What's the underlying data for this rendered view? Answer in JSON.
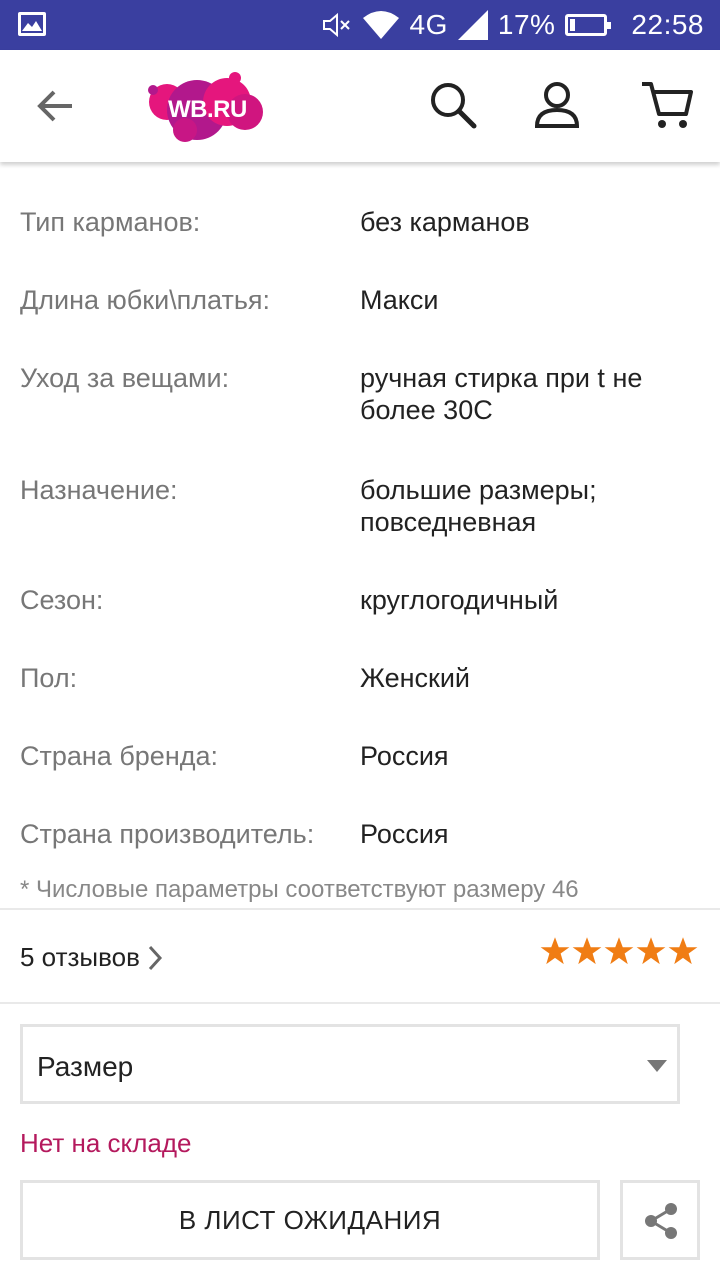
{
  "status_bar": {
    "network": "4G",
    "battery_percent": "17%",
    "battery_level": 0.17,
    "time": "22:58",
    "icons": [
      "gallery-icon",
      "mute-icon",
      "wifi-icon",
      "signal-icon",
      "battery-icon"
    ]
  },
  "app_bar": {
    "logo_text": "WB.RU",
    "icons": [
      "back-arrow-icon",
      "search-icon",
      "profile-icon",
      "cart-icon"
    ],
    "colors": {
      "logo_pink": "#e5167d",
      "logo_purple": "#b2188c"
    }
  },
  "properties": [
    {
      "label": "Тип карманов:",
      "value": "без карманов"
    },
    {
      "label": "Длина юбки\\платья:",
      "value": "Макси"
    },
    {
      "label": "Уход за вещами:",
      "value": "ручная стирка при t не более 30С"
    },
    {
      "label": "Назначение:",
      "value": "большие размеры; повседневная"
    },
    {
      "label": "Сезон:",
      "value": "круглогодичный"
    },
    {
      "label": "Пол:",
      "value": "Женский"
    },
    {
      "label": "Страна бренда:",
      "value": "Россия"
    },
    {
      "label": "Страна производитель:",
      "value": "Россия"
    }
  ],
  "footnote": "* Числовые параметры соответствуют размеру 46",
  "reviews": {
    "label": "5 отзывов",
    "rating": 5,
    "max_rating": 5,
    "star_color": "#f07d14"
  },
  "size_select": {
    "value": "Размер"
  },
  "stock_status": {
    "text": "Нет на складе",
    "color": "#b4195d"
  },
  "wait_list_button": {
    "label": "В ЛИСТ ОЖИДАНИЯ"
  },
  "share_button": {
    "icon": "share-icon"
  }
}
